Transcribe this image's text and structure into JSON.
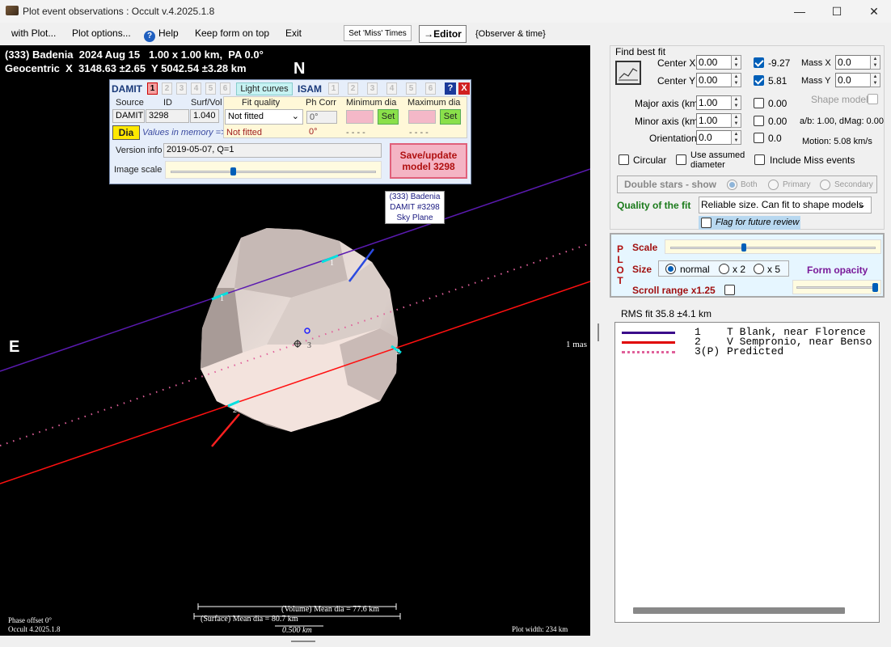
{
  "window": {
    "title": "Plot event observations : Occult v.4.2025.1.8"
  },
  "menu": [
    "with Plot...",
    "Plot options...",
    "Help",
    "Keep form on top",
    "Exit"
  ],
  "toolbar": {
    "set_miss": "Set 'Miss' Times",
    "editor": "→Editor",
    "observer_time": "{Observer & time}"
  },
  "plot": {
    "header1": "(333) Badenia  2024 Aug 15   1.00 x 1.00 km,  PA 0.0°",
    "header2": "Geocentric  X  3148.63 ±2.65  Y 5042.54 ±3.28 km",
    "north": "N",
    "east": "E",
    "mas": "1 mas",
    "label_box": [
      "(333) Badenia",
      "DAMIT #3298",
      "Sky Plane"
    ],
    "phase_offset": "Phase offset 0°",
    "version": "Occult 4.2025.1.8",
    "plot_width": "Plot width: 234 km",
    "volume_dia": "(Volume) Mean dia = 77.6 km",
    "surface_dia": "(Surface) Mean dia = 80.7 km",
    "scale_bar": "0.500 km",
    "chord_labels": [
      "1",
      "1",
      "2",
      "2",
      "3"
    ]
  },
  "damit": {
    "title": "DAMIT",
    "nums": [
      "1",
      "2",
      "3",
      "4",
      "5",
      "6"
    ],
    "light_curves": "Light curves",
    "isam": "ISAM",
    "isam_nums": [
      "1",
      "2",
      "3",
      "4",
      "5",
      "6"
    ],
    "help": "?",
    "close": "X",
    "source_hdr": "Source",
    "id_hdr": "ID",
    "surf_hdr": "Surf/Vol",
    "source": "DAMIT",
    "id": "3298",
    "surf_vol": "1.040",
    "dia_btn": "Dia",
    "values_mem": "Values in memory =>",
    "fit_quality_hdr": "Fit quality",
    "fit_quality": "Not fitted",
    "fit_quality_mem": "Not fitted",
    "ph_corr_hdr": "Ph Corr",
    "ph_corr": "0°",
    "ph_corr_mem": "0°",
    "min_dia_hdr": "Minimum dia",
    "max_dia_hdr": "Maximum dia",
    "set": "Set",
    "min_mem": "- - - -",
    "max_mem": "- - - -",
    "version_info_lbl": "Version info",
    "version_info": "2019-05-07, Q=1",
    "image_scale_lbl": "Image scale",
    "save_btn": "Save/update model 3298"
  },
  "fit": {
    "title": "Find best fit",
    "center_x_lbl": "Center X",
    "center_x": "0.00",
    "center_x_res": "-9.27",
    "center_y_lbl": "Center Y",
    "center_y": "0.00",
    "center_y_res": "5.81",
    "mass_x_lbl": "Mass X",
    "mass_x": "0.0",
    "mass_y_lbl": "Mass Y",
    "mass_y": "0.0",
    "major_lbl": "Major axis (km)",
    "major": "1.00",
    "major_res": "0.00",
    "minor_lbl": "Minor axis (km)",
    "minor": "1.00",
    "minor_res": "0.00",
    "orient_lbl": "Orientation",
    "orient": "0.0",
    "orient_res": "0.0",
    "shape_model": "Shape model",
    "ab": "a/b: 1.00, dMag: 0.00",
    "motion": "Motion: 5.08 km/s",
    "circular": "Circular",
    "assumed_dia": "Use assumed diameter",
    "include_miss": "Include Miss events",
    "double_stars": "Double stars - show",
    "both": "Both",
    "primary": "Primary",
    "secondary": "Secondary",
    "quality_lbl": "Quality of the fit",
    "quality": "Reliable size. Can fit to shape models",
    "flag_review": "Flag for future review"
  },
  "plotpanel": {
    "letters": [
      "P",
      "L",
      "O",
      "T"
    ],
    "scale": "Scale",
    "size": "Size",
    "normal": "normal",
    "x2": "x 2",
    "x5": "x 5",
    "form_opacity": "Form opacity",
    "scroll_range": "Scroll range x1.25"
  },
  "rms": "RMS fit 35.8 ±4.1 km",
  "legend": [
    {
      "num": "1",
      "text": "T Blank, near Florence",
      "color": "#3a0a8a",
      "style": "solid"
    },
    {
      "num": "2",
      "text": "V Sempronio, near Benso",
      "color": "#e00000",
      "style": "solid"
    },
    {
      "num": "3(P)",
      "text": "Predicted",
      "color": "#e0609a",
      "style": "dotted"
    }
  ],
  "colors": {
    "chord1": "#5a1ab0",
    "chord2": "#ff1010",
    "predicted": "#e0609a",
    "plot_bg": "#000000",
    "panel_blue": "#e6eefa"
  }
}
